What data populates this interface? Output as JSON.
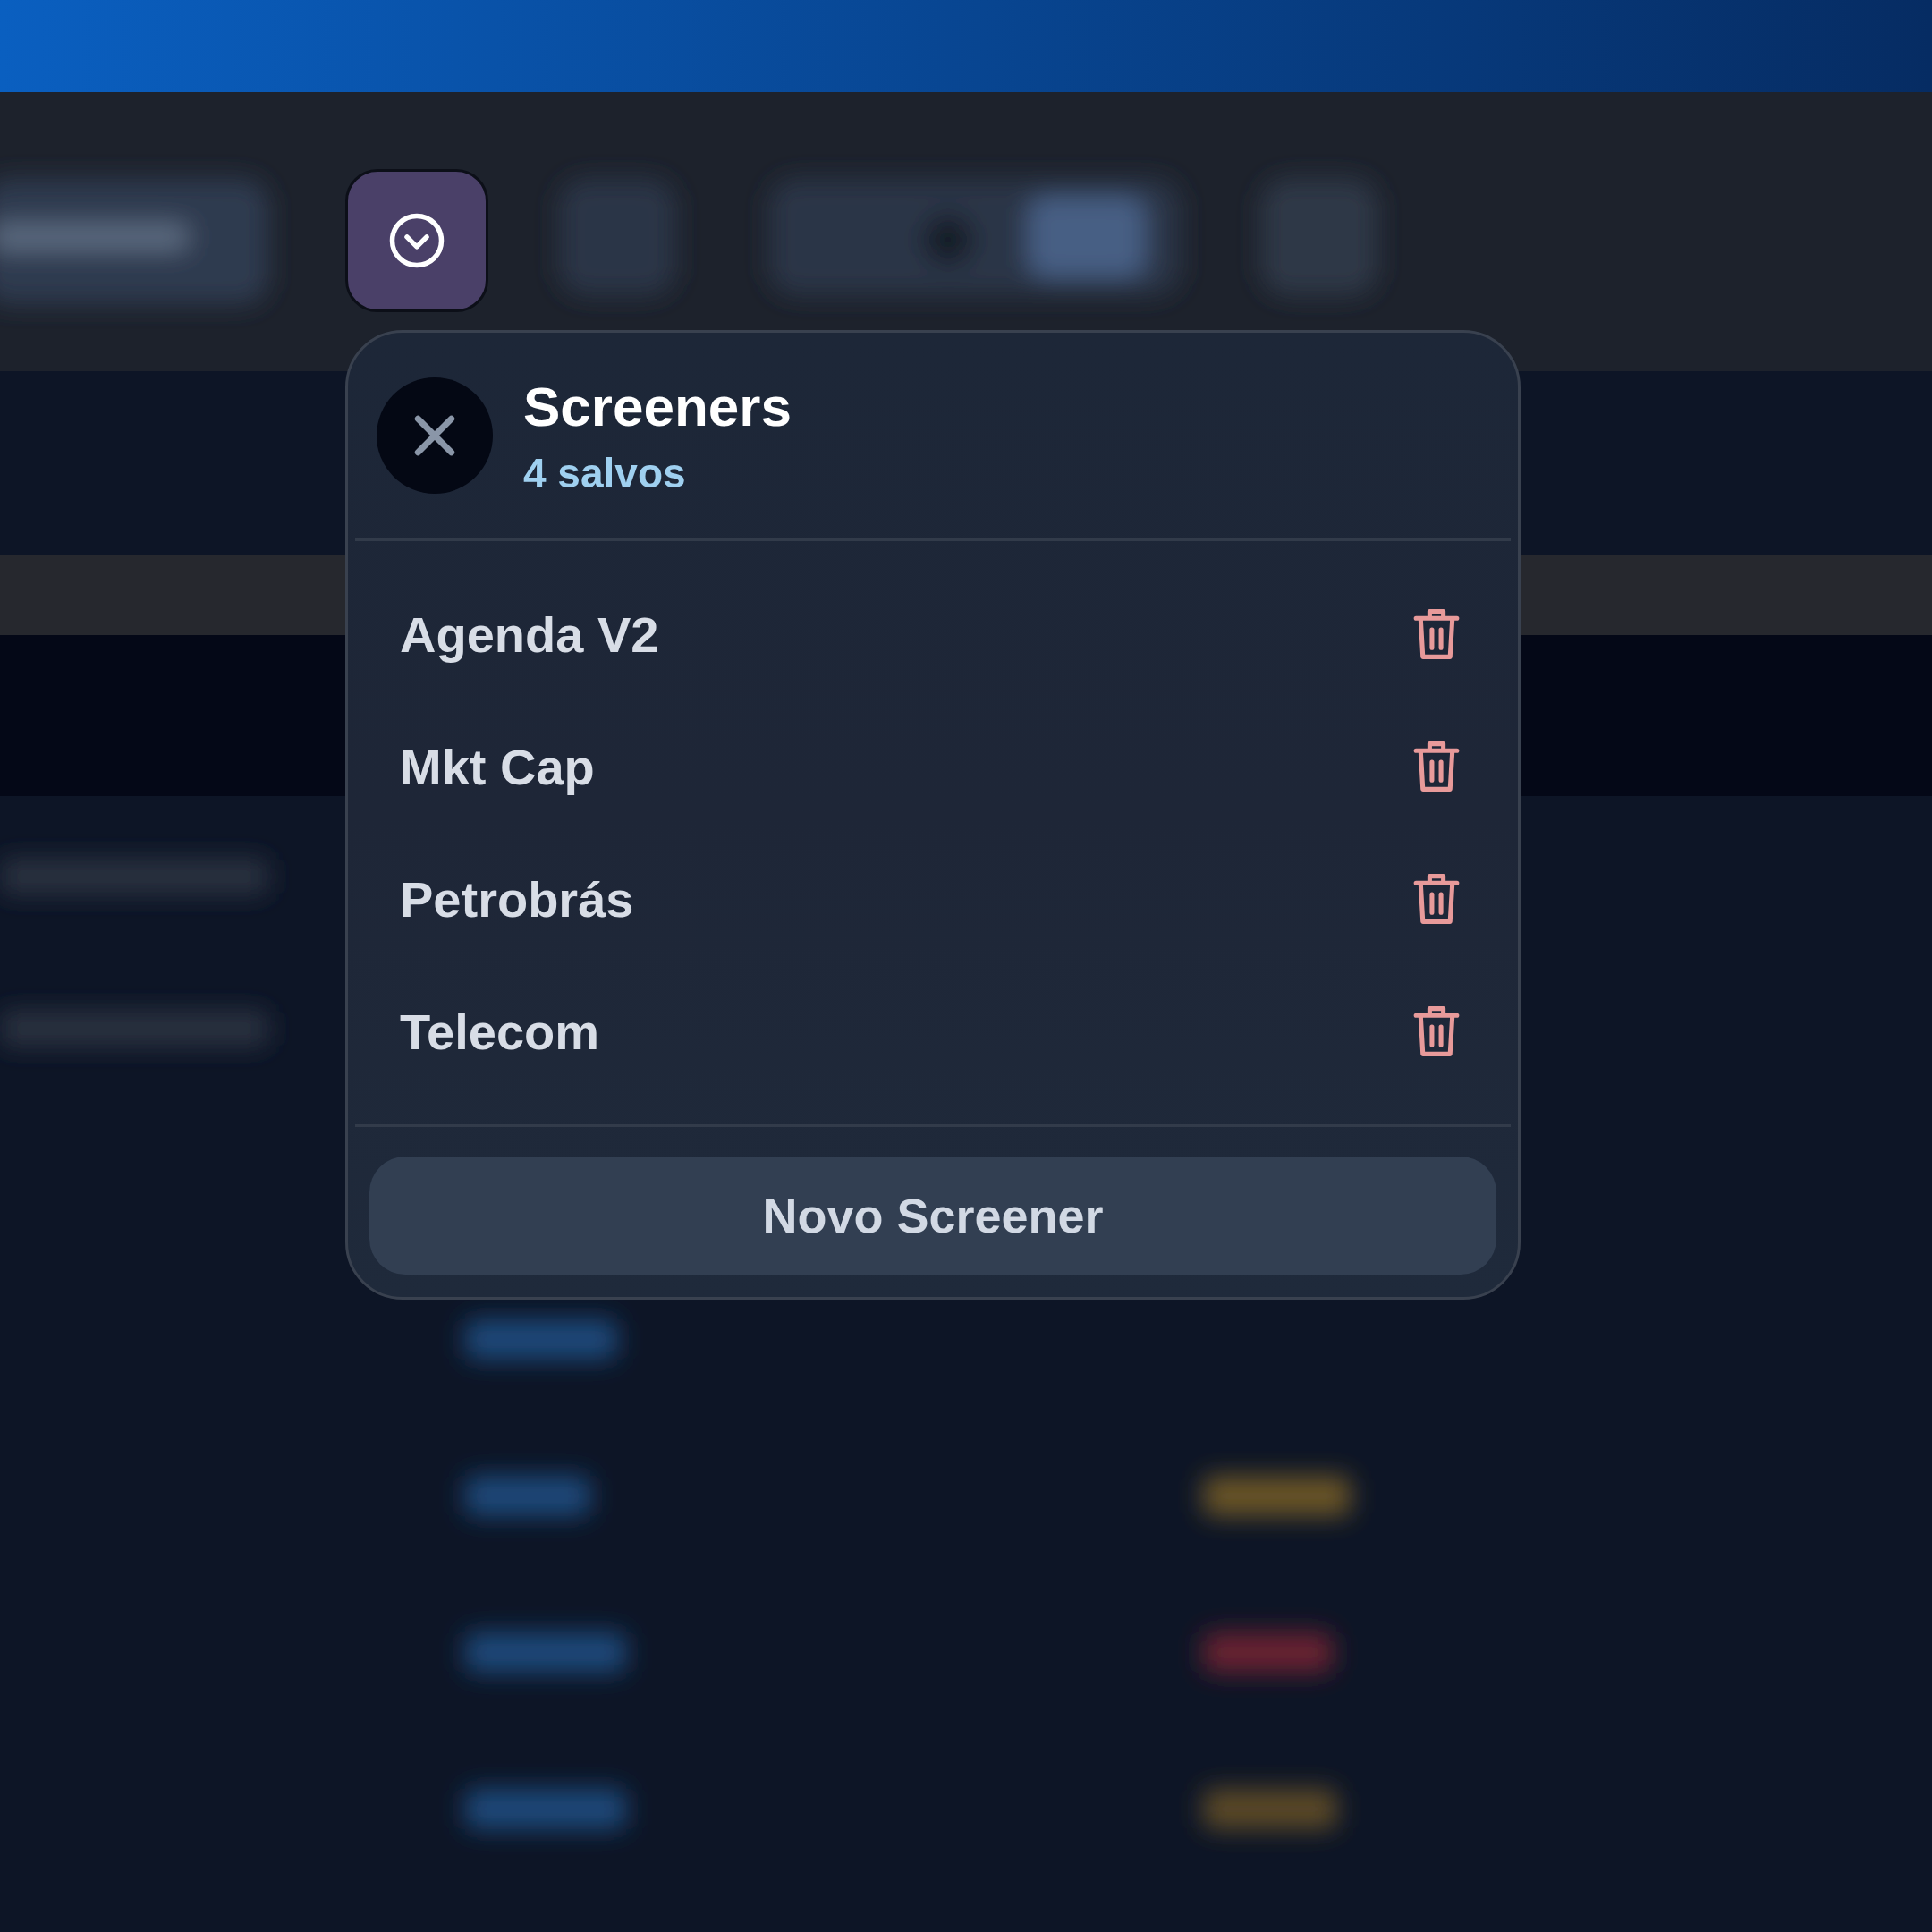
{
  "popover": {
    "title": "Screeners",
    "subtitle": "4 salvos",
    "items": [
      {
        "name": "Agenda V2"
      },
      {
        "name": "Mkt Cap"
      },
      {
        "name": "Petrobrás"
      },
      {
        "name": "Telecom"
      }
    ],
    "button": "Novo Screener"
  }
}
